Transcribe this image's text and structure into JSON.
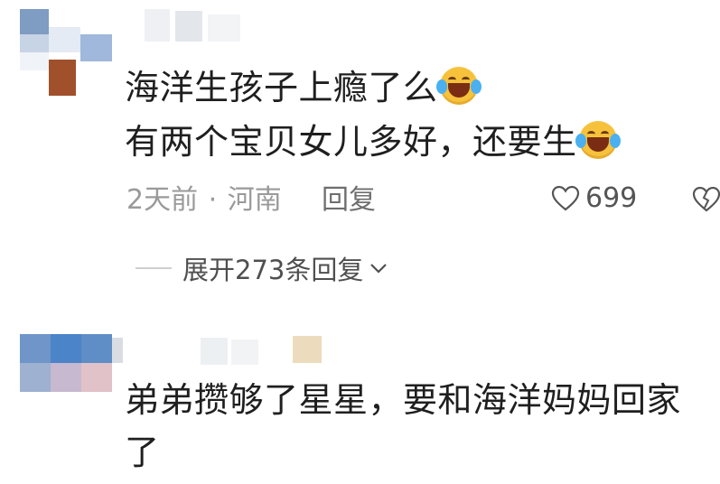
{
  "comments": [
    {
      "lines": [
        "海洋生孩子上瘾了么",
        "有两个宝贝女儿多好，还要生"
      ],
      "emoji": "laughing-tears-emoji",
      "time": "2天前",
      "separator": "·",
      "location": "河南",
      "reply_label": "回复",
      "like_count": "699"
    },
    {
      "lines": [
        "弟弟攒够了星星，要和海洋妈妈回家",
        "了"
      ]
    }
  ],
  "expand_replies_label": "展开273条回复",
  "icons": {
    "like": "heart-outline-icon",
    "dislike": "broken-heart-icon",
    "expand": "chevron-down-icon"
  },
  "colors": {
    "text": "#1f1f1f",
    "meta": "#9a9a9a",
    "emoji": "#f6c23c"
  }
}
